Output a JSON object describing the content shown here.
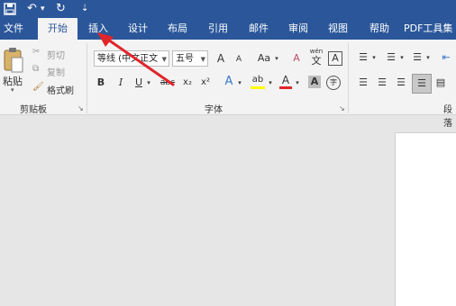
{
  "qat": {
    "save_icon": "save-icon",
    "undo_glyph": "↶",
    "redo_glyph": "↻",
    "dropdown_glyph": "▾",
    "customize_glyph": "⇣"
  },
  "tabs": [
    {
      "label": "文件"
    },
    {
      "label": "开始"
    },
    {
      "label": "插入"
    },
    {
      "label": "设计"
    },
    {
      "label": "布局"
    },
    {
      "label": "引用"
    },
    {
      "label": "邮件"
    },
    {
      "label": "审阅"
    },
    {
      "label": "视图"
    },
    {
      "label": "帮助"
    },
    {
      "label": "PDF工具集"
    }
  ],
  "clipboard": {
    "paste_label": "粘贴",
    "cut_label": "剪切",
    "copy_label": "复制",
    "format_painter_label": "格式刷",
    "group_label": "剪贴板"
  },
  "font": {
    "font_name": "等线 (中文正文",
    "font_size": "五号",
    "grow_glyph": "A",
    "shrink_glyph": "A",
    "case_glyph": "Aa",
    "clear_glyph": "A",
    "phonetic_top": "wén",
    "phonetic_bottom": "文",
    "char_border_glyph": "A",
    "bold": "B",
    "italic": "I",
    "underline": "U",
    "strike": "abc",
    "subscript": "x₂",
    "superscript": "x²",
    "text_effect_glyph": "A",
    "highlight_glyph": "ab",
    "font_color_glyph": "A",
    "char_shading_glyph": "A",
    "enclose_glyph": "字",
    "group_label": "字体"
  },
  "paragraph": {
    "group_label": "段落"
  },
  "colors": {
    "brand": "#2b579a",
    "arrow": "#e0262b",
    "highlight": "#ffff00",
    "font_color": "#e0262b"
  }
}
